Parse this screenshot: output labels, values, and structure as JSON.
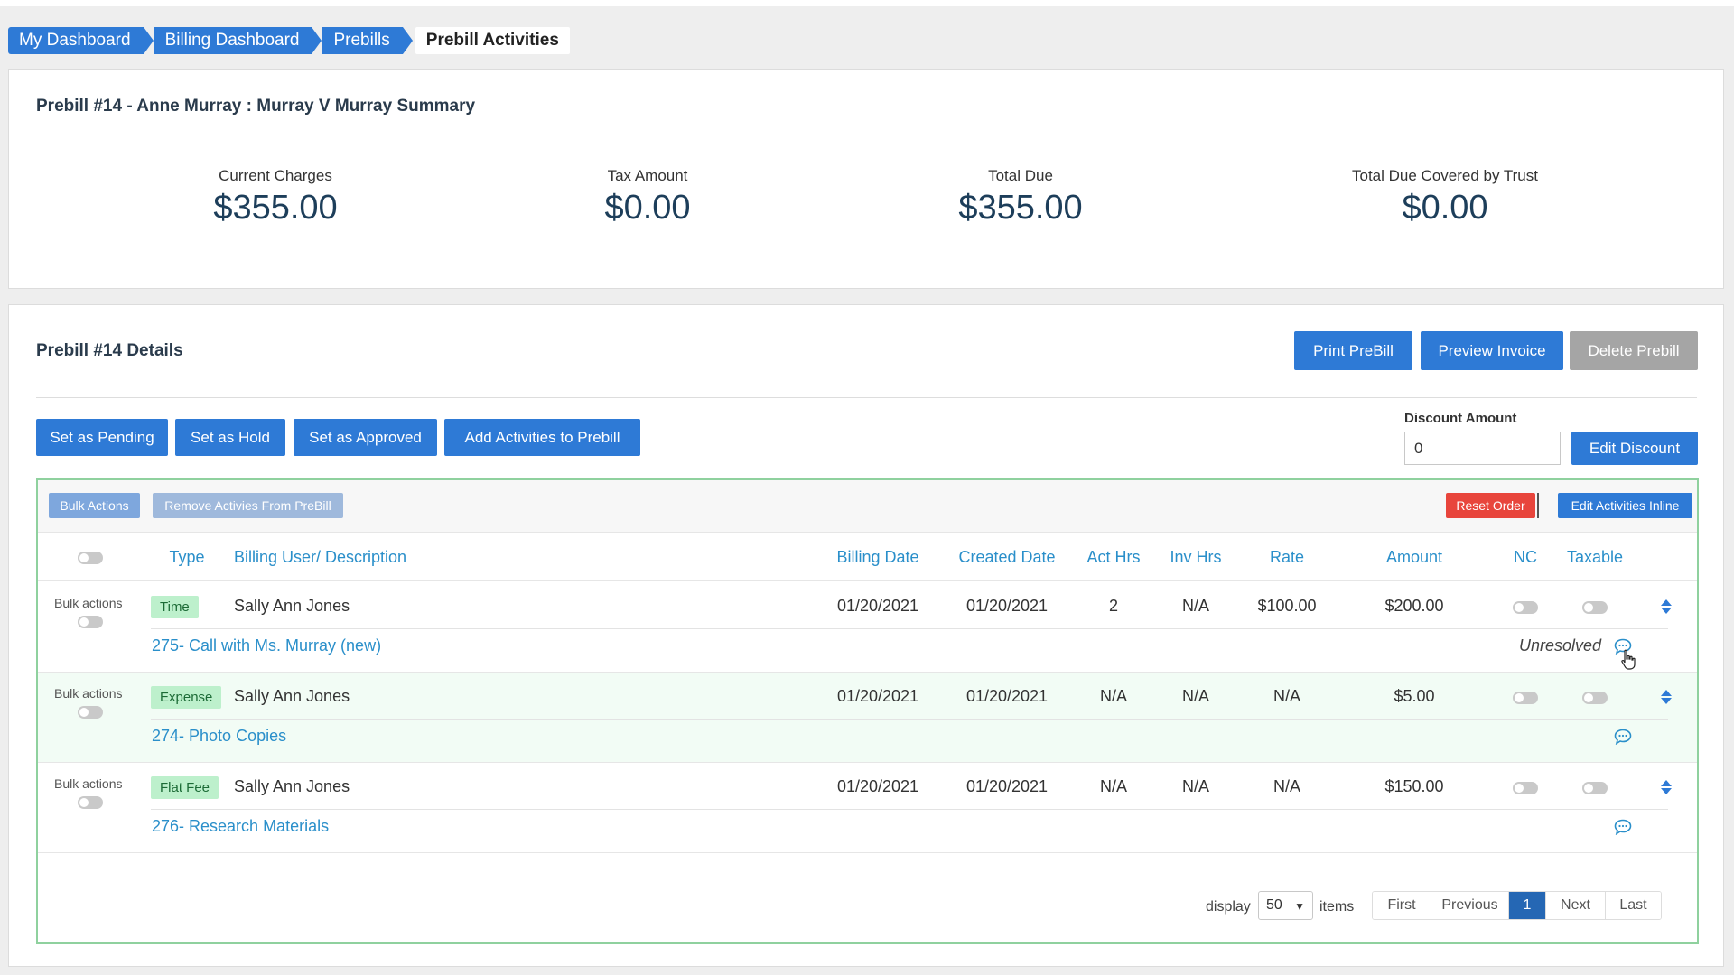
{
  "breadcrumb": [
    "My Dashboard",
    "Billing Dashboard",
    "Prebills",
    "Prebill Activities"
  ],
  "summary": {
    "title": "Prebill #14 - Anne Murray : Murray V Murray Summary",
    "metrics": [
      {
        "label": "Current Charges",
        "value": "$355.00"
      },
      {
        "label": "Tax Amount",
        "value": "$0.00"
      },
      {
        "label": "Total Due",
        "value": "$355.00"
      },
      {
        "label": "Total Due Covered by Trust",
        "value": "$0.00"
      }
    ]
  },
  "details": {
    "title": "Prebill #14 Details",
    "print_button": "Print PreBill",
    "preview_button": "Preview Invoice",
    "delete_button": "Delete Prebill",
    "status_buttons": [
      "Set as Pending",
      "Set as Hold",
      "Set as Approved",
      "Add Activities to Prebill"
    ],
    "discount": {
      "label": "Discount Amount",
      "value": "0",
      "button": "Edit Discount"
    }
  },
  "toolbar": {
    "bulk_actions": "Bulk Actions",
    "remove": "Remove Activies From PreBill",
    "reset_order": "Reset Order",
    "edit_inline": "Edit Activities Inline"
  },
  "table": {
    "headers": {
      "type": "Type",
      "user": "Billing User/ Description",
      "billing_date": "Billing Date",
      "created_date": "Created Date",
      "act_hrs": "Act Hrs",
      "inv_hrs": "Inv Hrs",
      "rate": "Rate",
      "amount": "Amount",
      "nc": "NC",
      "taxable": "Taxable"
    },
    "rows": [
      {
        "bulk": "Bulk actions",
        "type": "Time",
        "user": "Sally Ann Jones",
        "billing_date": "01/20/2021",
        "created_date": "01/20/2021",
        "act_hrs": "2",
        "inv_hrs": "N/A",
        "rate": "$100.00",
        "amount": "$200.00",
        "description": "275- Call with Ms. Murray (new)",
        "status": "Unresolved"
      },
      {
        "bulk": "Bulk actions",
        "type": "Expense",
        "user": "Sally Ann Jones",
        "billing_date": "01/20/2021",
        "created_date": "01/20/2021",
        "act_hrs": "N/A",
        "inv_hrs": "N/A",
        "rate": "N/A",
        "amount": "$5.00",
        "description": "274- Photo Copies",
        "status": ""
      },
      {
        "bulk": "Bulk actions",
        "type": "Flat Fee",
        "user": "Sally Ann Jones",
        "billing_date": "01/20/2021",
        "created_date": "01/20/2021",
        "act_hrs": "N/A",
        "inv_hrs": "N/A",
        "rate": "N/A",
        "amount": "$150.00",
        "description": "276- Research Materials",
        "status": ""
      }
    ]
  },
  "pagination": {
    "display_label": "display",
    "per_page": "50",
    "items_label": "items",
    "first": "First",
    "previous": "Previous",
    "current": "1",
    "next": "Next",
    "last": "Last"
  },
  "colors": {
    "primary": "#2e7ad6",
    "danger": "#e8453c",
    "badge_bg": "#bdf0cc",
    "link": "#2a8fca",
    "border_green": "#8fd19e"
  },
  "icons": [
    "comment-icon",
    "sort-arrows-icon",
    "hand-pointer-icon",
    "chevron-down-icon"
  ]
}
